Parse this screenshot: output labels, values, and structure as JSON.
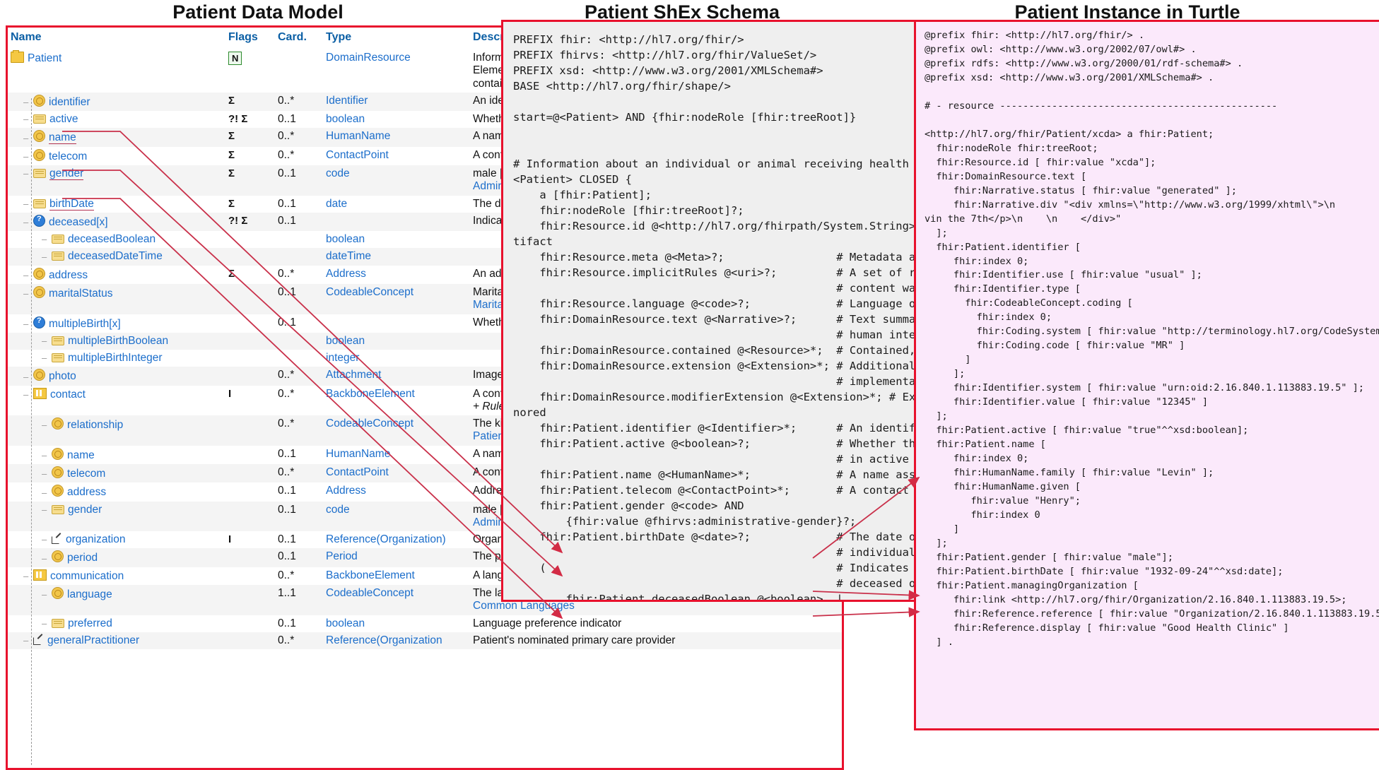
{
  "titles": {
    "model": "Patient Data Model",
    "shex": "Patient ShEx Schema",
    "turtle": "Patient Instance in Turtle"
  },
  "model_table": {
    "headers": [
      "Name",
      "Flags",
      "Card.",
      "Type",
      "Description"
    ],
    "rows": [
      {
        "indent": 0,
        "icon": "resource-icon",
        "name": "Patient",
        "flags": "N",
        "flag_boxed": true,
        "card": "",
        "type": "DomainResource",
        "desc": "Information about an individual or animal receiving health care services",
        "desc2": "Elements defined in Ancestors: id, meta, implicitRules, language, text, contained"
      },
      {
        "indent": 1,
        "icon": "datatype-icon",
        "name": "identifier",
        "flags": "Σ",
        "card": "0..*",
        "type": "Identifier",
        "desc": "An identifier for this patient"
      },
      {
        "indent": 1,
        "icon": "primitive-icon",
        "name": "active",
        "flags": "?! Σ",
        "card": "0..1",
        "type": "boolean",
        "desc": "Whether this patient's record is in active use"
      },
      {
        "indent": 1,
        "icon": "datatype-icon",
        "name": "name",
        "flags": "Σ",
        "card": "0..*",
        "type": "HumanName",
        "desc": "A name associated with the patient",
        "underline": true
      },
      {
        "indent": 1,
        "icon": "datatype-icon",
        "name": "telecom",
        "flags": "Σ",
        "card": "0..*",
        "type": "ContactPoint",
        "desc": "A contact detail for the individual"
      },
      {
        "indent": 1,
        "icon": "primitive-icon",
        "name": "gender",
        "flags": "Σ",
        "card": "0..1",
        "type": "code",
        "desc": "male | female | other | unknown",
        "desc_link": "AdministrativeGender",
        "underline": true
      },
      {
        "indent": 1,
        "icon": "primitive-icon",
        "name": "birthDate",
        "flags": "Σ",
        "card": "0..1",
        "type": "date",
        "desc": "The date of birth for the individual",
        "underline": true
      },
      {
        "indent": 1,
        "icon": "choice-icon",
        "name": "deceased[x]",
        "flags": "?! Σ",
        "card": "0..1",
        "type": "",
        "desc": "Indicates if the individual is deceased or not"
      },
      {
        "indent": 2,
        "icon": "primitive-icon",
        "name": "deceasedBoolean",
        "flags": "",
        "card": "",
        "type": "boolean",
        "desc": ""
      },
      {
        "indent": 2,
        "icon": "primitive-icon",
        "name": "deceasedDateTime",
        "flags": "",
        "card": "",
        "type": "dateTime",
        "desc": ""
      },
      {
        "indent": 1,
        "icon": "datatype-icon",
        "name": "address",
        "flags": "Σ",
        "card": "0..*",
        "type": "Address",
        "desc": "An address for the individual"
      },
      {
        "indent": 1,
        "icon": "datatype-icon",
        "name": "maritalStatus",
        "flags": "",
        "card": "0..1",
        "type": "CodeableConcept",
        "desc": "Marital (civil) status of a patient",
        "desc_link": "MaritalStatus"
      },
      {
        "indent": 1,
        "icon": "choice-icon",
        "name": "multipleBirth[x]",
        "flags": "",
        "card": "0..1",
        "type": "",
        "desc": "Whether patient is part of a multiple birth"
      },
      {
        "indent": 2,
        "icon": "primitive-icon",
        "name": "multipleBirthBoolean",
        "flags": "",
        "card": "",
        "type": "boolean",
        "desc": ""
      },
      {
        "indent": 2,
        "icon": "primitive-icon",
        "name": "multipleBirthInteger",
        "flags": "",
        "card": "",
        "type": "integer",
        "desc": ""
      },
      {
        "indent": 1,
        "icon": "datatype-icon",
        "name": "photo",
        "flags": "",
        "card": "0..*",
        "type": "Attachment",
        "desc": "Image of the patient"
      },
      {
        "indent": 1,
        "icon": "backbone-icon",
        "name": "contact",
        "flags": "I",
        "card": "0..*",
        "type": "BackboneElement",
        "desc": "A contact party (e.g. guardian, partner, friend) for the patient",
        "desc2": "+ Rule: SHALL at least contain a contact's details or a reference"
      },
      {
        "indent": 2,
        "icon": "datatype-icon",
        "name": "relationship",
        "flags": "",
        "card": "0..*",
        "type": "CodeableConcept",
        "desc": "The kind of relationship",
        "desc_link": "Patient Contact Relationship"
      },
      {
        "indent": 2,
        "icon": "datatype-icon",
        "name": "name",
        "flags": "",
        "card": "0..1",
        "type": "HumanName",
        "desc": "A name associated with the contact person"
      },
      {
        "indent": 2,
        "icon": "datatype-icon",
        "name": "telecom",
        "flags": "",
        "card": "0..*",
        "type": "ContactPoint",
        "desc": "A contact detail for the person"
      },
      {
        "indent": 2,
        "icon": "datatype-icon",
        "name": "address",
        "flags": "",
        "card": "0..1",
        "type": "Address",
        "desc": "Address for the contact person"
      },
      {
        "indent": 2,
        "icon": "primitive-icon",
        "name": "gender",
        "flags": "",
        "card": "0..1",
        "type": "code",
        "desc": "male | female | other | unknown",
        "desc_link": "AdministrativeGender"
      },
      {
        "indent": 2,
        "icon": "reference-icon",
        "name": "organization",
        "flags": "I",
        "card": "0..1",
        "type": "Reference(Organization)",
        "desc": "Organization that is associated with the contact"
      },
      {
        "indent": 2,
        "icon": "datatype-icon",
        "name": "period",
        "flags": "",
        "card": "0..1",
        "type": "Period",
        "desc": "The period during which this contact person or organization is valid"
      },
      {
        "indent": 1,
        "icon": "backbone-icon",
        "name": "communication",
        "flags": "",
        "card": "0..*",
        "type": "BackboneElement",
        "desc": "A language which may be used to communicate with the patient"
      },
      {
        "indent": 2,
        "icon": "datatype-icon",
        "name": "language",
        "flags": "",
        "card": "1..1",
        "type": "CodeableConcept",
        "desc": "The language which can be used to communicate",
        "desc_link": "Common Languages"
      },
      {
        "indent": 2,
        "icon": "primitive-icon",
        "name": "preferred",
        "flags": "",
        "card": "0..1",
        "type": "boolean",
        "desc": "Language preference indicator"
      },
      {
        "indent": 1,
        "icon": "reference-icon",
        "name": "generalPractitioner",
        "flags": "",
        "card": "0..*",
        "type": "Reference(Organization",
        "desc": "Patient's nominated primary care provider"
      }
    ]
  },
  "shex": {
    "code": "PREFIX fhir: <http://hl7.org/fhir/>\nPREFIX fhirvs: <http://hl7.org/fhir/ValueSet/>\nPREFIX xsd: <http://www.w3.org/2001/XMLSchema#>\nBASE <http://hl7.org/fhir/shape/>\n\nstart=@<Patient> AND {fhir:nodeRole [fhir:treeRoot]}\n\n\n# Information about an individual or animal receiving health care services\n<Patient> CLOSED {\n    a [fhir:Patient];\n    fhir:nodeRole [fhir:treeRoot]?;\n    fhir:Resource.id @<http://hl7.org/fhirpath/System.String>?;  # Logical id of this ar\ntifact\n    fhir:Resource.meta @<Meta>?;                 # Metadata about the resource\n    fhir:Resource.implicitRules @<uri>?;         # A set of rules under which this\n                                                 # content was created\n    fhir:Resource.language @<code>?;             # Language of the resource\n    fhir:DomainResource.text @<Narrative>?;      # Text summary of the resource,\n                                                 # human interpretation\n    fhir:DomainResource.contained @<Resource>*;  # Contained, inline Resources\n    fhir:DomainResource.extension @<Extension>*; # Additional content defined by\n                                                 # implementations\n    fhir:DomainResource.modifierExtension @<Extension>*; # Extensions that cannot be ig\nnored\n    fhir:Patient.identifier @<Identifier>*;      # An identifier for this patient\n    fhir:Patient.active @<boolean>?;             # Whether this patient's record is\n                                                 # in active use\n    fhir:Patient.name @<HumanName>*;             # A name associated with the patient\n    fhir:Patient.telecom @<ContactPoint>*;       # A contact detail for the individual\n    fhir:Patient.gender @<code> AND\n        {fhir:value @fhirvs:administrative-gender}?;\n    fhir:Patient.birthDate @<date>?;             # The date of birth for the\n                                                 # individual\n    (                                            # Indicates if the individual is\n                                                 # deceased or not\n        fhir:Patient.deceasedBoolean @<boolean>  |\n        fhir:Patient.deceasedDateTime @<dateTime>\n    )?;"
  },
  "turtle": {
    "code": "@prefix fhir: <http://hl7.org/fhir/> .\n@prefix owl: <http://www.w3.org/2002/07/owl#> .\n@prefix rdfs: <http://www.w3.org/2000/01/rdf-schema#> .\n@prefix xsd: <http://www.w3.org/2001/XMLSchema#> .\n\n# - resource ------------------------------------------------\n\n<http://hl7.org/fhir/Patient/xcda> a fhir:Patient;\n  fhir:nodeRole fhir:treeRoot;\n  fhir:Resource.id [ fhir:value \"xcda\"];\n  fhir:DomainResource.text [\n     fhir:Narrative.status [ fhir:value \"generated\" ];\n     fhir:Narrative.div \"<div xmlns=\\\"http://www.w3.org/1999/xhtml\\\">\\n\nvin the 7th</p>\\n    \\n    </div>\"\n  ];\n  fhir:Patient.identifier [\n     fhir:index 0;\n     fhir:Identifier.use [ fhir:value \"usual\" ];\n     fhir:Identifier.type [\n       fhir:CodeableConcept.coding [\n         fhir:index 0;\n         fhir:Coding.system [ fhir:value \"http://terminology.hl7.org/CodeSystem/v2-0203\" ];\n         fhir:Coding.code [ fhir:value \"MR\" ]\n       ]\n     ];\n     fhir:Identifier.system [ fhir:value \"urn:oid:2.16.840.1.113883.19.5\" ];\n     fhir:Identifier.value [ fhir:value \"12345\" ]\n  ];\n  fhir:Patient.active [ fhir:value \"true\"^^xsd:boolean];\n  fhir:Patient.name [\n     fhir:index 0;\n     fhir:HumanName.family [ fhir:value \"Levin\" ];\n     fhir:HumanName.given [\n        fhir:value \"Henry\";\n        fhir:index 0\n     ]\n  ];\n  fhir:Patient.gender [ fhir:value \"male\"];\n  fhir:Patient.birthDate [ fhir:value \"1932-09-24\"^^xsd:date];\n  fhir:Patient.managingOrganization [\n     fhir:link <http://hl7.org/fhir/Organization/2.16.840.1.113883.19.5>;\n     fhir:Reference.reference [ fhir:value \"Organization/2.16.840.1.113883.19.5\" ];\n     fhir:Reference.display [ fhir:value \"Good Health Clinic\" ]\n  ] ."
  },
  "colors": {
    "panel_border": "#e8112d",
    "connector": "#cc2244",
    "link": "#1c6ecb",
    "shex_bg": "#efefef",
    "turtle_bg": "#fbe9fb"
  }
}
